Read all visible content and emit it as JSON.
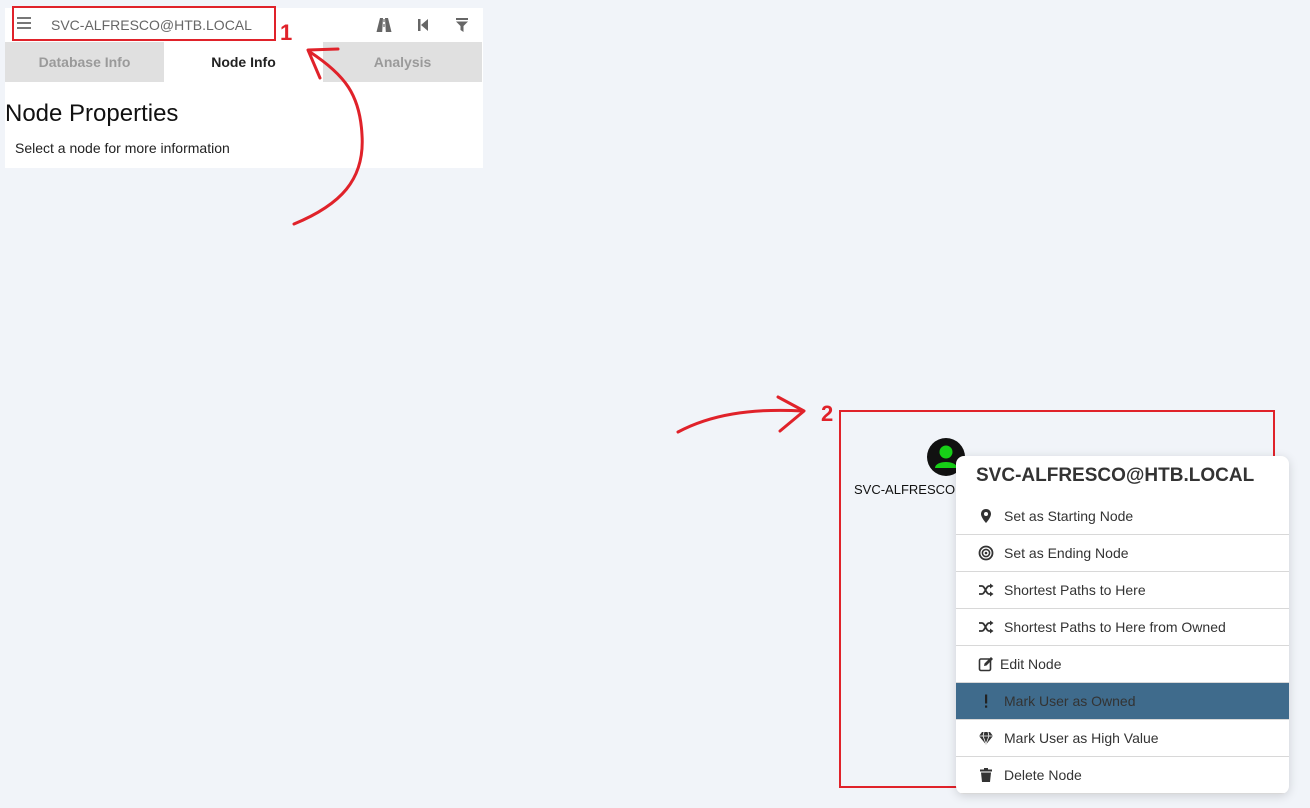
{
  "search": {
    "value": "SVC-ALFRESCO@HTB.LOCAL"
  },
  "toolbar": {
    "icons": [
      "road-icon",
      "back-icon",
      "filter-icon"
    ]
  },
  "tabs": [
    {
      "label": "Database Info",
      "active": false
    },
    {
      "label": "Node Info",
      "active": true
    },
    {
      "label": "Analysis",
      "active": false
    }
  ],
  "node_panel": {
    "title": "Node Properties",
    "subtitle": "Select a node for more information"
  },
  "annotations": {
    "one": "1",
    "two": "2",
    "color": "#e0222a"
  },
  "graph": {
    "node": {
      "label": "SVC-ALFRESCO@HTB.LOCAL",
      "icon": "user-icon",
      "color": "#17d017"
    }
  },
  "context_menu": {
    "title": "SVC-ALFRESCO@HTB.LOCAL",
    "items": [
      {
        "label": "Set as Starting Node",
        "icon": "map-marker-icon"
      },
      {
        "label": "Set as Ending Node",
        "icon": "bullseye-icon"
      },
      {
        "label": "Shortest Paths to Here",
        "icon": "random-icon"
      },
      {
        "label": "Shortest Paths to Here from Owned",
        "icon": "random-icon"
      },
      {
        "label": "Edit Node",
        "icon": "edit-icon"
      },
      {
        "label": "Mark User as Owned",
        "icon": "exclamation-icon",
        "highlighted": true
      },
      {
        "label": "Mark User as High Value",
        "icon": "gem-icon"
      },
      {
        "label": "Delete Node",
        "icon": "trash-icon"
      }
    ],
    "highlight_color": "#3f6b8c"
  }
}
